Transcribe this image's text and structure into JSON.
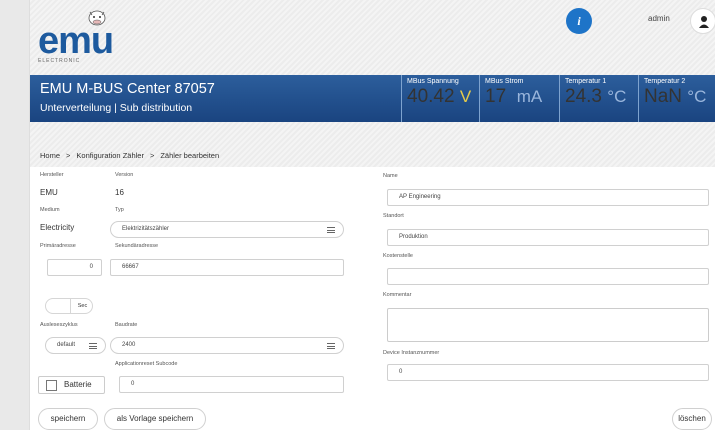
{
  "header": {
    "logo_text": "emu",
    "logo_sub": "ELECTRONIC",
    "info_icon": "i",
    "user": "admin"
  },
  "banner": {
    "title": "EMU M-BUS Center 87057",
    "subtitle": "Unterverteilung | Sub distribution"
  },
  "measurements": [
    {
      "label": "MBus Spannung",
      "value": "40.42",
      "unit": "V",
      "unit_color": "#e6cc4a"
    },
    {
      "label": "MBus Strom",
      "value": "17",
      "unit": "mA",
      "unit_color": "#9ab6dc"
    },
    {
      "label": "Temperatur 1",
      "value": "24.3",
      "unit": "°C",
      "unit_color": "#9ab6dc"
    },
    {
      "label": "Temperatur 2",
      "value": "NaN",
      "unit": "°C",
      "unit_color": "#9ab6dc"
    }
  ],
  "breadcrumb": {
    "home": "Home",
    "sep": ">",
    "config": "Konfiguration Zähler",
    "edit": "Zähler bearbeiten"
  },
  "form": {
    "hersteller_label": "Hersteller",
    "hersteller_value": "EMU",
    "version_label": "Version",
    "version_value": "16",
    "medium_label": "Medium",
    "medium_value": "Electricity",
    "typ_label": "Typ",
    "typ_value": "Elektrizitätszähler",
    "primaer_label": "Primäradresse",
    "primaer_value": "0",
    "sekundaer_label": "Sekundäradresse",
    "sekundaer_value": "66667",
    "sec_label": "Sec",
    "zyklus_label": "Ausleseszyklus",
    "zyklus_value": "default",
    "baud_label": "Baudrate",
    "baud_value": "2400",
    "appreset_label": "Applicationreset Subcode",
    "appreset_value": "0",
    "batterie_label": "Batterie",
    "name_label": "Name",
    "name_value": "AP Engineering",
    "standort_label": "Standort",
    "standort_value": "Produktion",
    "kosten_label": "Kostenstelle",
    "kosten_value": "",
    "kommentar_label": "Kommentar",
    "kommentar_value": "",
    "device_label": "Device Instanznummer",
    "device_value": "0"
  },
  "buttons": {
    "save": "speichern",
    "save_template": "als Vorlage speichern",
    "delete": "löschen"
  }
}
